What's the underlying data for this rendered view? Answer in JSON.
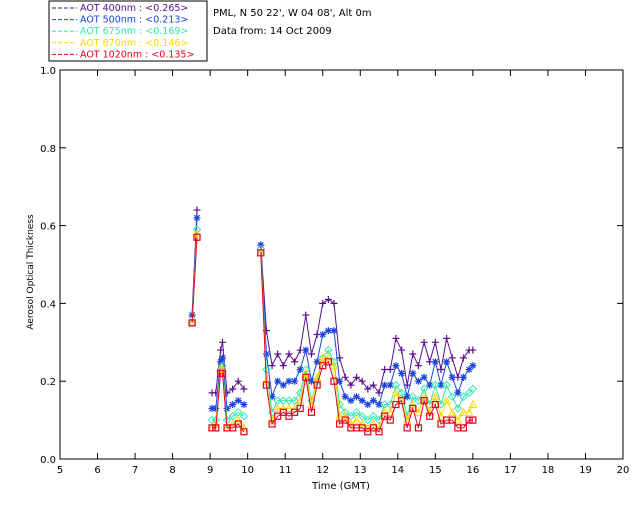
{
  "header": {
    "station": "PML, N 50 22', W 04 08', Alt 0m",
    "date_line": "Data from: 14 Oct 2009"
  },
  "colors": {
    "aot400": "#5a0f8c",
    "aot500": "#1a44dd",
    "aot675": "#33e6b3",
    "aot870": "#ffd700",
    "aot1020": "#e8001c",
    "axis": "#000000"
  },
  "chart_data": {
    "type": "line",
    "xlabel": "Time (GMT)",
    "ylabel": "Aerosol Optical Thickness",
    "xlim": [
      5,
      20
    ],
    "ylim": [
      0.0,
      1.0
    ],
    "x_ticks": [
      "5",
      "6",
      "7",
      "8",
      "9",
      "10",
      "11",
      "12",
      "13",
      "14",
      "15",
      "16",
      "17",
      "18",
      "19",
      "20"
    ],
    "y_ticks": [
      "0.0",
      "0.2",
      "0.4",
      "0.6",
      "0.8",
      "1.0"
    ],
    "grid": false,
    "legend_position": "top-left outside",
    "x": [
      8.52,
      8.65,
      9.05,
      9.15,
      9.28,
      9.33,
      9.45,
      9.6,
      9.75,
      9.9,
      10.35,
      10.5,
      10.65,
      10.8,
      10.95,
      11.1,
      11.25,
      11.4,
      11.55,
      11.7,
      11.85,
      12.0,
      12.15,
      12.3,
      12.45,
      12.6,
      12.75,
      12.9,
      13.05,
      13.2,
      13.35,
      13.5,
      13.65,
      13.8,
      13.95,
      14.1,
      14.25,
      14.4,
      14.55,
      14.7,
      14.85,
      15.0,
      15.15,
      15.3,
      15.45,
      15.6,
      15.75,
      15.9,
      16.0
    ],
    "series": [
      {
        "name": "AOT  400nm : <0.265>",
        "color_key": "aot400",
        "marker": "plus",
        "values": [
          0.37,
          0.64,
          0.17,
          0.17,
          0.28,
          0.3,
          0.17,
          0.18,
          0.2,
          0.18,
          0.55,
          0.33,
          0.24,
          0.27,
          0.24,
          0.27,
          0.25,
          0.28,
          0.37,
          0.27,
          0.32,
          0.4,
          0.41,
          0.4,
          0.26,
          0.21,
          0.19,
          0.21,
          0.2,
          0.18,
          0.19,
          0.17,
          0.23,
          0.23,
          0.31,
          0.28,
          0.19,
          0.27,
          0.24,
          0.3,
          0.25,
          0.3,
          0.23,
          0.31,
          0.26,
          0.21,
          0.26,
          0.28,
          0.28
        ]
      },
      {
        "name": "AOT  500nm : <0.213>",
        "color_key": "aot500",
        "marker": "asterisk",
        "values": [
          0.37,
          0.62,
          0.13,
          0.13,
          0.25,
          0.26,
          0.13,
          0.14,
          0.15,
          0.14,
          0.55,
          0.27,
          0.16,
          0.2,
          0.19,
          0.2,
          0.2,
          0.23,
          0.28,
          0.2,
          0.25,
          0.32,
          0.33,
          0.33,
          0.2,
          0.16,
          0.15,
          0.16,
          0.15,
          0.14,
          0.15,
          0.14,
          0.19,
          0.19,
          0.24,
          0.22,
          0.16,
          0.22,
          0.2,
          0.21,
          0.19,
          0.25,
          0.19,
          0.25,
          0.21,
          0.17,
          0.21,
          0.23,
          0.24
        ]
      },
      {
        "name": "AOT  675nm : <0.169>",
        "color_key": "aot675",
        "marker": "diamond",
        "values": [
          0.35,
          0.59,
          0.1,
          0.1,
          0.23,
          0.24,
          0.1,
          0.11,
          0.12,
          0.11,
          0.54,
          0.23,
          0.12,
          0.15,
          0.15,
          0.15,
          0.15,
          0.17,
          0.23,
          0.15,
          0.2,
          0.26,
          0.28,
          0.25,
          0.14,
          0.12,
          0.11,
          0.12,
          0.11,
          0.1,
          0.11,
          0.1,
          0.14,
          0.14,
          0.19,
          0.17,
          0.11,
          0.16,
          0.15,
          0.18,
          0.14,
          0.19,
          0.14,
          0.19,
          0.16,
          0.13,
          0.16,
          0.17,
          0.18
        ]
      },
      {
        "name": "AOT  870nm : <0.146>",
        "color_key": "aot870",
        "marker": "triangle",
        "values": [
          0.35,
          0.58,
          0.08,
          0.09,
          0.23,
          0.23,
          0.08,
          0.09,
          0.1,
          0.08,
          0.53,
          0.2,
          0.1,
          0.13,
          0.13,
          0.13,
          0.13,
          0.15,
          0.22,
          0.14,
          0.21,
          0.26,
          0.26,
          0.24,
          0.11,
          0.11,
          0.09,
          0.1,
          0.09,
          0.08,
          0.09,
          0.08,
          0.12,
          0.12,
          0.17,
          0.15,
          0.1,
          0.14,
          0.12,
          0.16,
          0.12,
          0.16,
          0.11,
          0.15,
          0.12,
          0.1,
          0.12,
          0.12,
          0.14
        ]
      },
      {
        "name": "AOT 1020nm : <0.135>",
        "color_key": "aot1020",
        "marker": "square",
        "values": [
          0.35,
          0.57,
          0.08,
          0.08,
          0.22,
          0.22,
          0.08,
          0.08,
          0.09,
          0.07,
          0.53,
          0.19,
          0.09,
          0.11,
          0.12,
          0.11,
          0.12,
          0.13,
          0.21,
          0.12,
          0.19,
          0.24,
          0.25,
          0.2,
          0.09,
          0.1,
          0.08,
          0.08,
          0.08,
          0.07,
          0.08,
          0.07,
          0.11,
          0.1,
          0.14,
          0.15,
          0.08,
          0.13,
          0.08,
          0.15,
          0.11,
          0.14,
          0.09,
          0.1,
          0.1,
          0.08,
          0.08,
          0.1,
          0.1
        ]
      }
    ]
  }
}
